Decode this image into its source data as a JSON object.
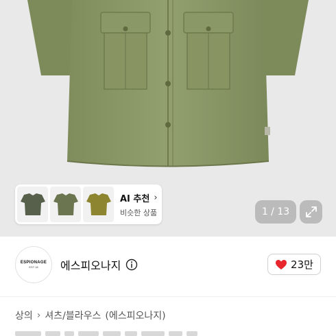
{
  "gallery": {
    "current_page": "1",
    "total_pages": "13",
    "pager_text": "1 / 13",
    "ai_recommend": {
      "title": "AI 추천",
      "subtitle": "비슷한 상품",
      "thumbnails": [
        {
          "color": "#56604a"
        },
        {
          "color": "#6b7650"
        },
        {
          "color": "#8e8530"
        }
      ]
    },
    "product_color": "#8d9a6a"
  },
  "shop": {
    "logo_text": "ESPIONAGE",
    "logo_subtext": "EST 18",
    "name": "에스피오나지",
    "likes": "23만",
    "heart_color": "#e8262d"
  },
  "breadcrumb": {
    "category": "상의",
    "subcategory": "셔츠/블라우스",
    "brand": "(에스피오나지)"
  }
}
